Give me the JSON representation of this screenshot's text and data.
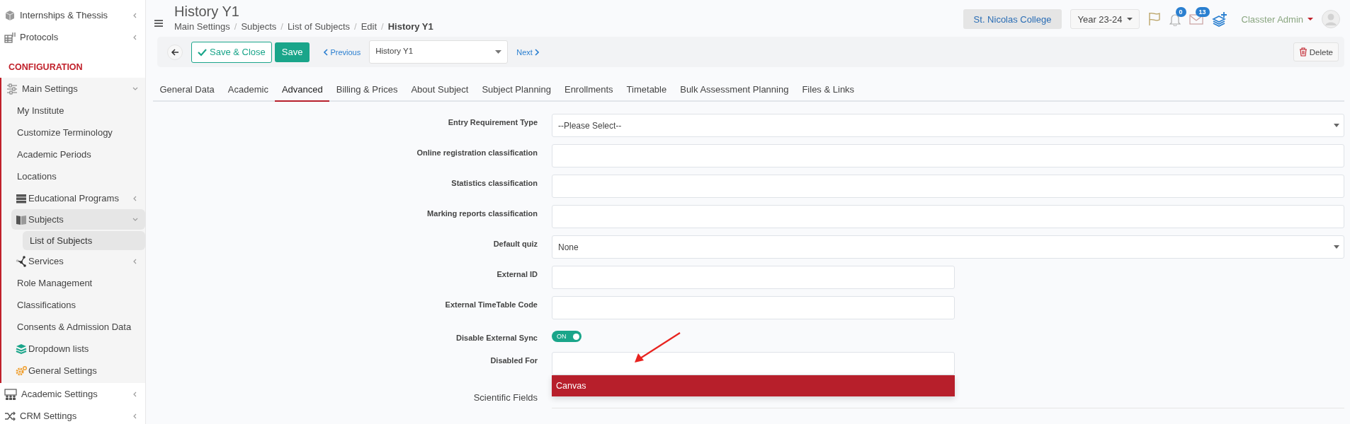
{
  "sidebar": {
    "items": [
      {
        "kind": "icon-link",
        "label": "Internships & Thessis",
        "expanded": false,
        "selected": false
      },
      {
        "kind": "icon-link",
        "label": "Protocols",
        "expanded": false,
        "selected": false
      },
      {
        "kind": "heading",
        "label": "CONFIGURATION"
      },
      {
        "kind": "icon-link",
        "label": "Main Settings",
        "expanded": true,
        "selected": false,
        "children": [
          {
            "kind": "link",
            "label": "My Institute",
            "selected": false
          },
          {
            "kind": "link",
            "label": "Customize Terminology",
            "selected": false
          },
          {
            "kind": "link",
            "label": "Academic Periods",
            "selected": false
          },
          {
            "kind": "link",
            "label": "Locations",
            "selected": false
          },
          {
            "kind": "icon-link",
            "label": "Educational Programs",
            "expanded": false,
            "selected": false
          },
          {
            "kind": "icon-link",
            "label": "Subjects",
            "expanded": true,
            "selected": true,
            "children": [
              {
                "kind": "link",
                "label": "List of Subjects",
                "selected": true
              }
            ]
          },
          {
            "kind": "icon-link",
            "label": "Services",
            "expanded": false,
            "selected": false
          },
          {
            "kind": "link",
            "label": "Role Management",
            "selected": false
          },
          {
            "kind": "link",
            "label": "Classifications",
            "selected": false
          },
          {
            "kind": "link",
            "label": "Consents & Admission Data",
            "selected": false
          },
          {
            "kind": "icon-link",
            "label": "Dropdown lists",
            "selected": false
          },
          {
            "kind": "icon-link",
            "label": "General Settings",
            "selected": false
          }
        ]
      },
      {
        "kind": "icon-link",
        "label": "Academic Settings",
        "expanded": false,
        "selected": false
      },
      {
        "kind": "icon-link",
        "label": "CRM Settings",
        "expanded": false,
        "selected": false
      }
    ]
  },
  "header": {
    "title": "History Y1",
    "breadcrumb": [
      {
        "label": "Main Settings",
        "current": false
      },
      {
        "separator": "/",
        "label": "Subjects",
        "current": false
      },
      {
        "separator": "/",
        "label": "List of Subjects",
        "current": false
      },
      {
        "separator": "/",
        "label": "Edit",
        "current": false
      },
      {
        "separator": "/",
        "label": "History Y1",
        "current": true
      }
    ],
    "college": "St. Nicolas College",
    "year": "Year 23-24",
    "notifications": "0",
    "messages": "13",
    "user": "Classter Admin"
  },
  "toolbar": {
    "save_close": "Save & Close",
    "save": "Save",
    "previous": "Previous",
    "record": "History Y1",
    "next": "Next",
    "delete": "Delete"
  },
  "tabs": [
    {
      "label": "General Data",
      "selected": false
    },
    {
      "label": "Academic",
      "selected": false
    },
    {
      "label": "Advanced",
      "selected": true
    },
    {
      "label": "Billing & Prices",
      "selected": false
    },
    {
      "label": "About Subject",
      "selected": false
    },
    {
      "label": "Subject Planning",
      "selected": false
    },
    {
      "label": "Enrollments",
      "selected": false
    },
    {
      "label": "Timetable",
      "selected": false
    },
    {
      "label": "Bulk Assessment Planning",
      "selected": false
    },
    {
      "label": "Files & Links",
      "selected": false
    }
  ],
  "form": [
    {
      "kind": "select",
      "label": "Entry Requirement Type",
      "value": "--Please Select--"
    },
    {
      "kind": "input",
      "label": "Online registration classification"
    },
    {
      "kind": "input",
      "label": "Statistics classification"
    },
    {
      "kind": "input",
      "label": "Marking reports classification"
    },
    {
      "kind": "select",
      "label": "Default quiz",
      "value": "None"
    },
    {
      "kind": "short-input",
      "label": "External ID"
    },
    {
      "kind": "short-input",
      "label": "External TimeTable Code"
    },
    {
      "kind": "toggle",
      "label": "Disable External Sync",
      "on": true,
      "text": "ON"
    },
    {
      "kind": "multiselect",
      "label": "Disabled For",
      "options": [
        {
          "label": "Canvas",
          "highlighted": true
        }
      ]
    },
    {
      "kind": "covered",
      "label": "Scientific Fields"
    }
  ],
  "annotation_arrow": {
    "color": "#e8231f"
  }
}
